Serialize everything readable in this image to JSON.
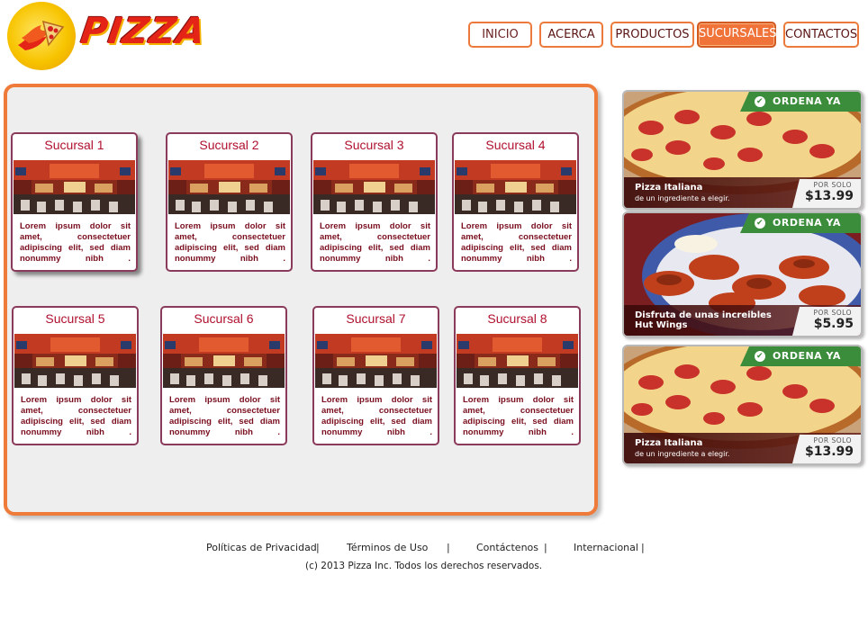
{
  "logo": {
    "text": "PIZZA"
  },
  "nav": {
    "items": [
      "INICIO",
      "ACERCA",
      "PRODUCTOS",
      "SUCURSALES",
      "CONTACTOS"
    ],
    "active": "SUCURSALES"
  },
  "sucursales": [
    {
      "title": "Sucursal 1",
      "text": "Lorem ipsum dolor sit amet, consectetuer adipiscing elit, sed diam nonummy nibh ."
    },
    {
      "title": "Sucursal 2",
      "text": "Lorem ipsum dolor sit amet, consectetuer adipiscing elit, sed diam nonummy nibh ."
    },
    {
      "title": "Sucursal 3",
      "text": "Lorem ipsum dolor sit amet, consectetuer adipiscing elit, sed diam nonummy nibh ."
    },
    {
      "title": "Sucursal 4",
      "text": "Lorem ipsum dolor sit amet, consectetuer adipiscing elit, sed diam nonummy nibh ."
    },
    {
      "title": "Sucursal 5",
      "text": "Lorem ipsum dolor sit amet, consectetuer adipiscing elit, sed diam nonummy nibh ."
    },
    {
      "title": "Sucursal 6",
      "text": "Lorem ipsum dolor sit amet, consectetuer adipiscing elit, sed diam nonummy nibh ."
    },
    {
      "title": "Sucursal 7",
      "text": "Lorem ipsum dolor sit amet, consectetuer adipiscing elit, sed diam nonummy nibh ."
    },
    {
      "title": "Sucursal 8",
      "text": "Lorem ipsum dolor sit amet, consectetuer adipiscing elit, sed diam nonummy nibh ."
    }
  ],
  "promos": [
    {
      "badge": "ORDENA YA",
      "name": "Pizza Italiana",
      "sub": "de un ingrediente a elegir.",
      "price_label": "POR SOLO",
      "price": "$13.99",
      "image": "pepperoni-pizza"
    },
    {
      "badge": "ORDENA YA",
      "name": "Disfruta de unas increibles",
      "sub": "Hut Wings",
      "price_label": "POR SOLO",
      "price": "$5.95",
      "image": "chicken-wings"
    },
    {
      "badge": "ORDENA YA",
      "name": "Pizza Italiana",
      "sub": "de un ingrediente a elegir.",
      "price_label": "POR SOLO",
      "price": "$13.99",
      "image": "pepperoni-pizza"
    }
  ],
  "footer": {
    "links": [
      "Políticas de Privacidad",
      "Términos de Uso",
      "Contáctenos",
      "Internacional"
    ],
    "separator": "|",
    "copyright": "(c) 2013 Pizza Inc. Todos los derechos reservados."
  },
  "colors": {
    "accent": "#ef7b3b",
    "title_red": "#b0102e",
    "badge_green": "#3b8c3b"
  }
}
